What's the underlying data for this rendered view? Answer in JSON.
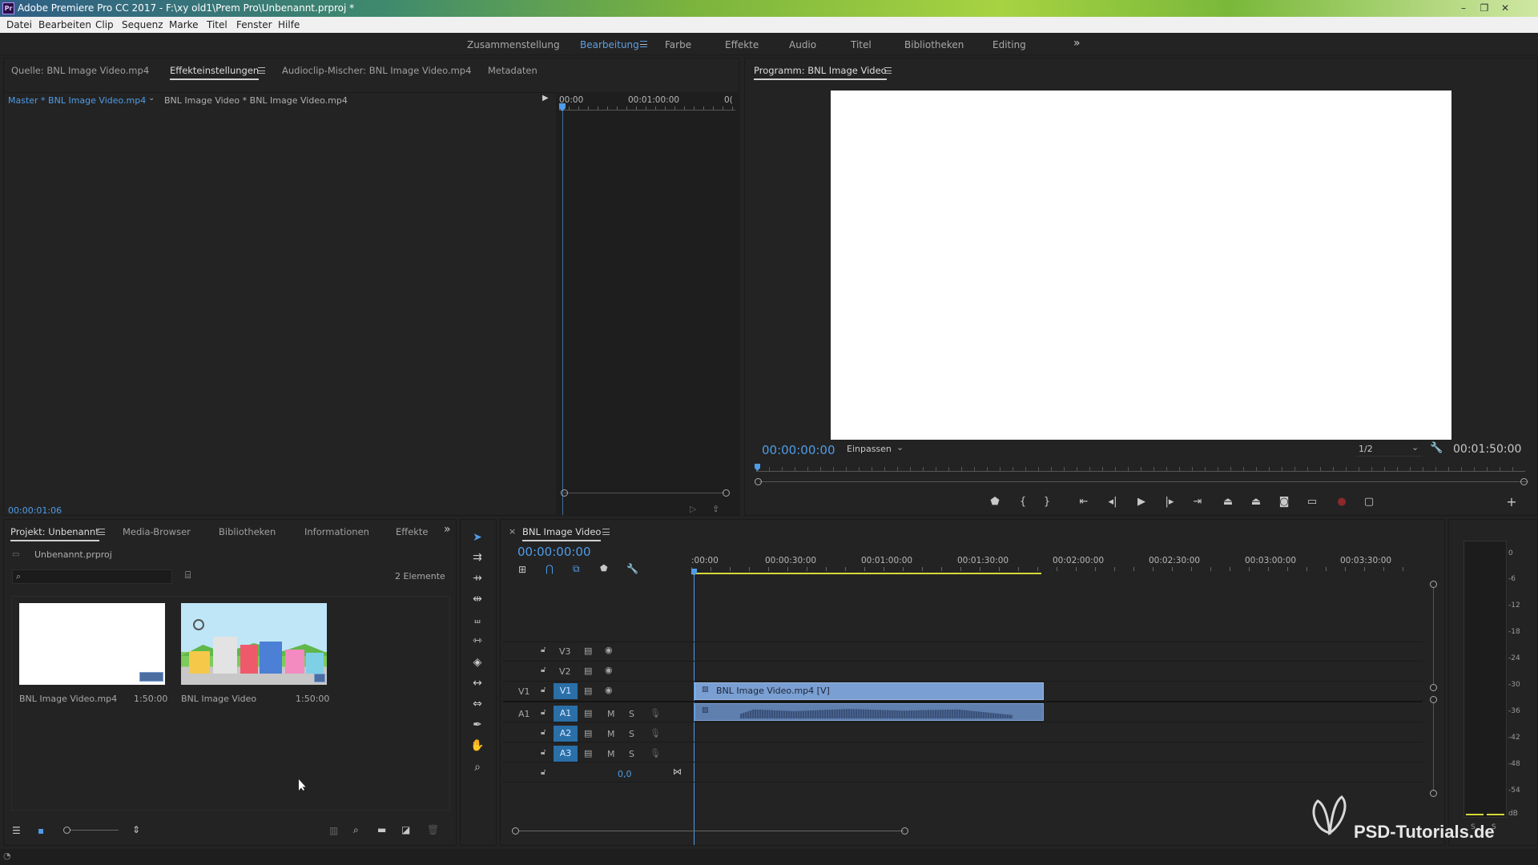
{
  "window": {
    "title": "Adobe Premiere Pro CC 2017 - F:\\xy old1\\Prem Pro\\Unbenannt.prproj *",
    "logo": "Pr",
    "controls": [
      "–",
      "❐",
      "✕"
    ]
  },
  "menu": [
    "Datei",
    "Bearbeiten",
    "Clip",
    "Sequenz",
    "Marke",
    "Titel",
    "Fenster",
    "Hilfe"
  ],
  "workspaces": {
    "items": [
      "Zusammenstellung",
      "Bearbeitung",
      "Farbe",
      "Effekte",
      "Audio",
      "Titel",
      "Bibliotheken",
      "Editing"
    ],
    "active": "Bearbeitung",
    "overflow": "»"
  },
  "source_panel": {
    "tabs": [
      "Quelle: BNL Image Video.mp4",
      "Effekteinstellungen",
      "Audioclip-Mischer: BNL Image Video.mp4",
      "Metadaten"
    ],
    "active_tab": "Effekteinstellungen",
    "master_label": "Master * BNL Image Video.mp4",
    "clip_label": "BNL Image Video * BNL Image Video.mp4",
    "ruler": [
      "00:00",
      "00:01:00:00",
      "0("
    ],
    "timecode": "00:00:01:06"
  },
  "program_monitor": {
    "title": "Programm: BNL Image Video",
    "timecode": "00:00:00:00",
    "fit": "Einpassen",
    "resolution": "1/2",
    "duration": "00:01:50:00",
    "add_button": "+"
  },
  "project_panel": {
    "tabs": [
      "Projekt: Unbenannt",
      "Media-Browser",
      "Bibliotheken",
      "Informationen",
      "Effekte"
    ],
    "active_tab": "Projekt: Unbenannt",
    "file_name": "Unbenannt.prproj",
    "search_placeholder": "",
    "item_count": "2 Elemente",
    "items": [
      {
        "name": "BNL Image Video.mp4",
        "duration": "1:50:00"
      },
      {
        "name": "BNL Image Video",
        "duration": "1:50:00"
      }
    ]
  },
  "timeline": {
    "title": "BNL Image Video",
    "timecode": "00:00:00:00",
    "ruler": [
      ":00:00",
      "00:00:30:00",
      "00:01:00:00",
      "00:01:30:00",
      "00:02:00:00",
      "00:02:30:00",
      "00:03:00:00",
      "00:03:30:00"
    ],
    "tracks": {
      "video": [
        {
          "src": "",
          "target": "V3"
        },
        {
          "src": "",
          "target": "V2"
        },
        {
          "src": "V1",
          "target": "V1"
        }
      ],
      "audio": [
        {
          "src": "A1",
          "target": "A1"
        },
        {
          "src": "",
          "target": "A2"
        },
        {
          "src": "",
          "target": "A3"
        }
      ],
      "master_value": "0,0"
    },
    "track_buttons": {
      "mute": "M",
      "solo": "S"
    },
    "clip_label": "BNL Image Video.mp4 [V]"
  },
  "audio_meter": {
    "ticks": [
      "0",
      "-6",
      "-12",
      "-18",
      "-24",
      "-30",
      "-36",
      "-42",
      "-48",
      "-54",
      "dB"
    ],
    "footer": [
      "S",
      "S"
    ]
  },
  "watermark": "PSD-Tutorials.de",
  "colors": {
    "accent": "#4f9ce8",
    "playhead": "#4f9ce8",
    "clip_video": "#7a9fd2",
    "clip_audio": "#5f7fae",
    "work_area": "#d8d83a"
  }
}
